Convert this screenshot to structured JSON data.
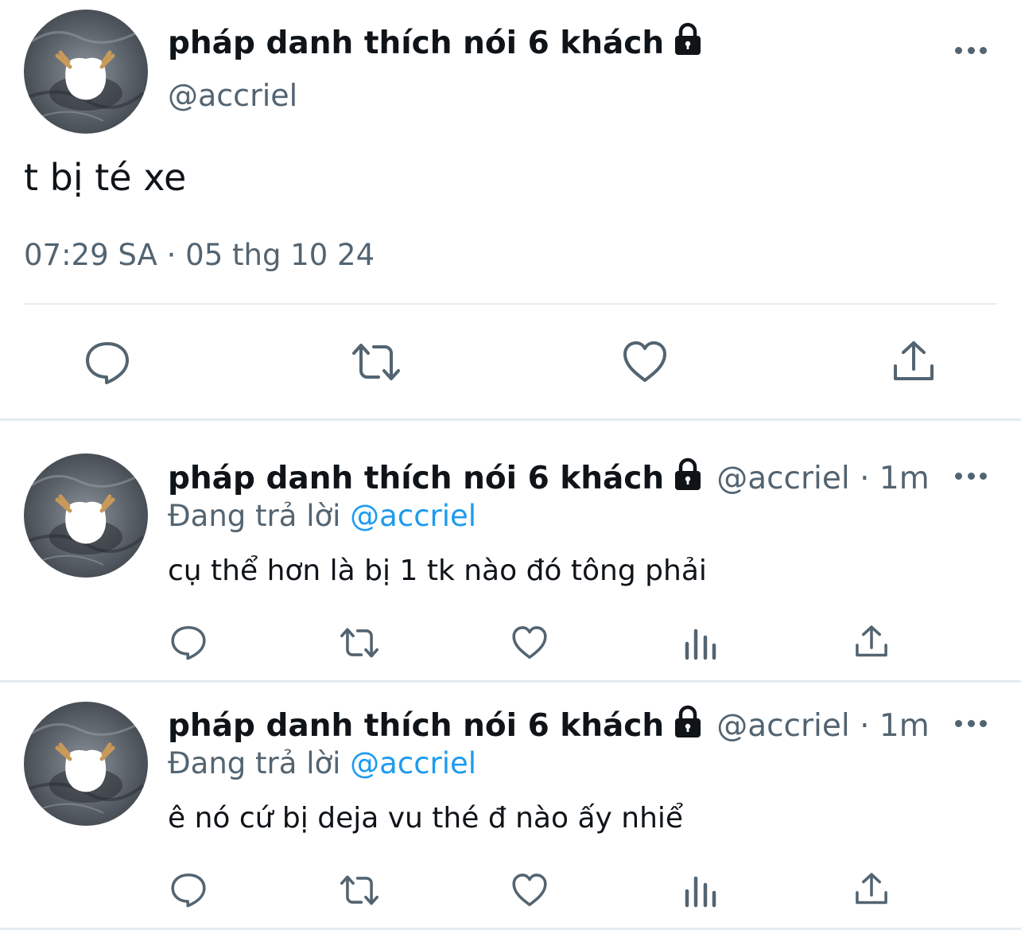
{
  "main_tweet": {
    "display_name": "pháp danh thích nói 6 khách",
    "handle": "@accriel",
    "text": "t bị té xe",
    "timestamp": "07:29 SA · 05 thg 10 24",
    "avatar_icon": "avatar-image",
    "lock_icon": "lock-icon",
    "actions": [
      "reply-icon",
      "retweet-icon",
      "like-icon",
      "share-icon"
    ]
  },
  "replies": [
    {
      "display_name": "pháp danh thích nói 6 khách",
      "handle_time": "@accriel · 1m",
      "replying_prefix": "Đang trả lời",
      "replying_mention": "@accriel",
      "text": "cụ thể hơn là bị 1 tk nào đó tông phải",
      "actions": [
        "reply-icon",
        "retweet-icon",
        "like-icon",
        "views-icon",
        "share-icon"
      ]
    },
    {
      "display_name": "pháp danh thích nói 6 khách",
      "handle_time": "@accriel · 1m",
      "replying_prefix": "Đang trả lời",
      "replying_mention": "@accriel",
      "text": "ê nó cứ bị deja vu thé đ nào ấy nhiể",
      "actions": [
        "reply-icon",
        "retweet-icon",
        "like-icon",
        "views-icon",
        "share-icon"
      ]
    }
  ],
  "colors": {
    "text_primary": "#0f1419",
    "text_secondary": "#536471",
    "mention": "#1d9bf0",
    "divider": "#e6ecf0"
  }
}
